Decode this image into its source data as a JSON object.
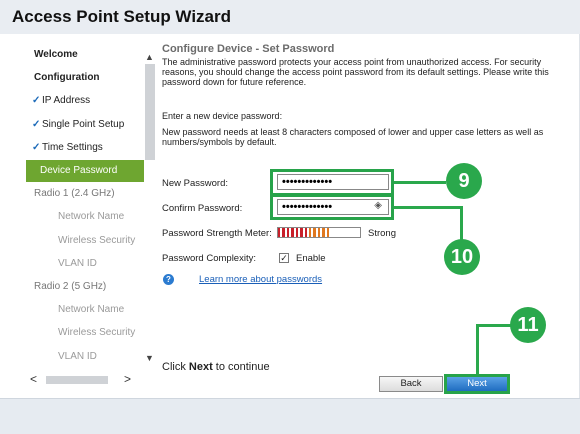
{
  "window": {
    "title": "Access Point Setup Wizard"
  },
  "sidebar": {
    "items": [
      {
        "label": "Welcome",
        "style": "bold"
      },
      {
        "label": "Configuration",
        "style": "bold"
      },
      {
        "label": "IP Address",
        "checked": true
      },
      {
        "label": "Single Point Setup",
        "checked": true
      },
      {
        "label": "Time Settings",
        "checked": true
      },
      {
        "label": "Device Password",
        "active": true
      },
      {
        "label": "Radio 1 (2.4 GHz)",
        "style": "section"
      },
      {
        "label": "Network Name",
        "style": "grey"
      },
      {
        "label": "Wireless Security",
        "style": "grey"
      },
      {
        "label": "VLAN ID",
        "style": "grey"
      },
      {
        "label": "Radio 2 (5 GHz)",
        "style": "section"
      },
      {
        "label": "Network Name",
        "style": "grey"
      },
      {
        "label": "Wireless Security",
        "style": "grey"
      },
      {
        "label": "VLAN ID",
        "style": "grey"
      }
    ],
    "check_glyph": "✓"
  },
  "main": {
    "heading": "Configure Device - Set Password",
    "intro": "The administrative password protects your access point from unauthorized access. For security reasons, you should change the access point password from its default settings. Please write this password down for future reference.",
    "enter_prompt": "Enter a new device password:",
    "requirement": "New password needs at least 8 characters composed of lower and upper case letters as well as numbers/symbols by default.",
    "new_password_label": "New Password:",
    "new_password_value": "•••••••••••••",
    "confirm_password_label": "Confirm Password:",
    "confirm_password_value": "•••••••••••••",
    "strength_label": "Password Strength Meter:",
    "strength_text": "Strong",
    "strength_level": 0.65,
    "complexity_label": "Password Complexity:",
    "complexity_checked": true,
    "complexity_option": "Enable",
    "learn_more_link": "Learn more about passwords",
    "footer_prefix": "Click ",
    "footer_bold": "Next",
    "footer_suffix": " to continue",
    "back_button": "Back",
    "next_button": "Next"
  },
  "callouts": [
    "9",
    "10",
    "11"
  ],
  "colors": {
    "accent_green": "#2aa84c",
    "nav_active": "#6ea630",
    "strength_red": "#c8202a",
    "strength_orange": "#e07820",
    "link_blue": "#1a5fb8"
  }
}
